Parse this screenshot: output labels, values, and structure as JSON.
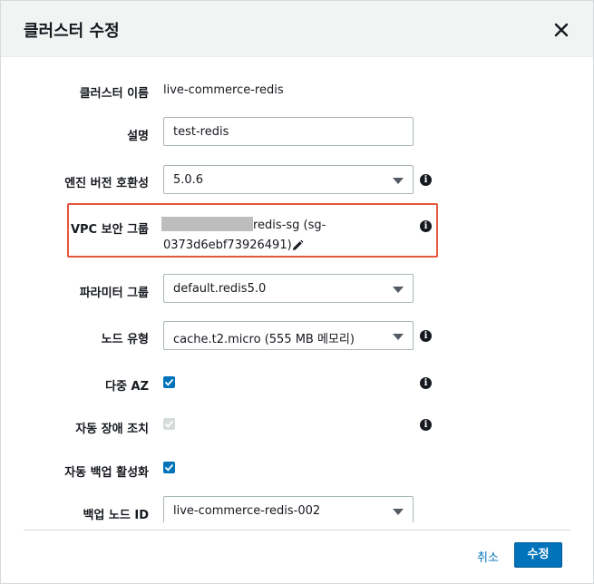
{
  "modal": {
    "title": "클러스터 수정",
    "close_icon": "close-icon"
  },
  "form": {
    "cluster_name": {
      "label": "클러스터 이름",
      "value": "live-commerce-redis"
    },
    "description": {
      "label": "설명",
      "value": "test-redis"
    },
    "engine_version": {
      "label": "엔진 버전 호환성",
      "value": "5.0.6",
      "info_icon": "info-icon"
    },
    "vpc_security_group": {
      "label": "VPC 보안 그룹",
      "value_line1": "redis-sg (sg-",
      "value_line2": "0373d6ebf73926491)",
      "edit_icon": "pencil-icon",
      "info_icon": "info-icon",
      "highlight_color": "#e4573b"
    },
    "parameter_group": {
      "label": "파라미터 그룹",
      "value": "default.redis5.0"
    },
    "node_type": {
      "label": "노드 유형",
      "value": "cache.t2.micro (555 MB 메모리)",
      "info_icon": "info-icon"
    },
    "multi_az": {
      "label": "다중 AZ",
      "checked": true,
      "info_icon": "info-icon"
    },
    "auto_failover": {
      "label": "자동 장애 조치",
      "checked": true,
      "disabled": true,
      "info_icon": "info-icon"
    },
    "auto_backup": {
      "label": "자동 백업 활성화",
      "checked": true
    },
    "backup_node_id": {
      "label": "백업 노드 ID",
      "value": "live-commerce-redis-002"
    }
  },
  "footer": {
    "cancel_label": "취소",
    "submit_label": "수정"
  },
  "colors": {
    "primary": "#0073bb",
    "header_bg": "#f2f3f3",
    "highlight": "#e4573b"
  }
}
